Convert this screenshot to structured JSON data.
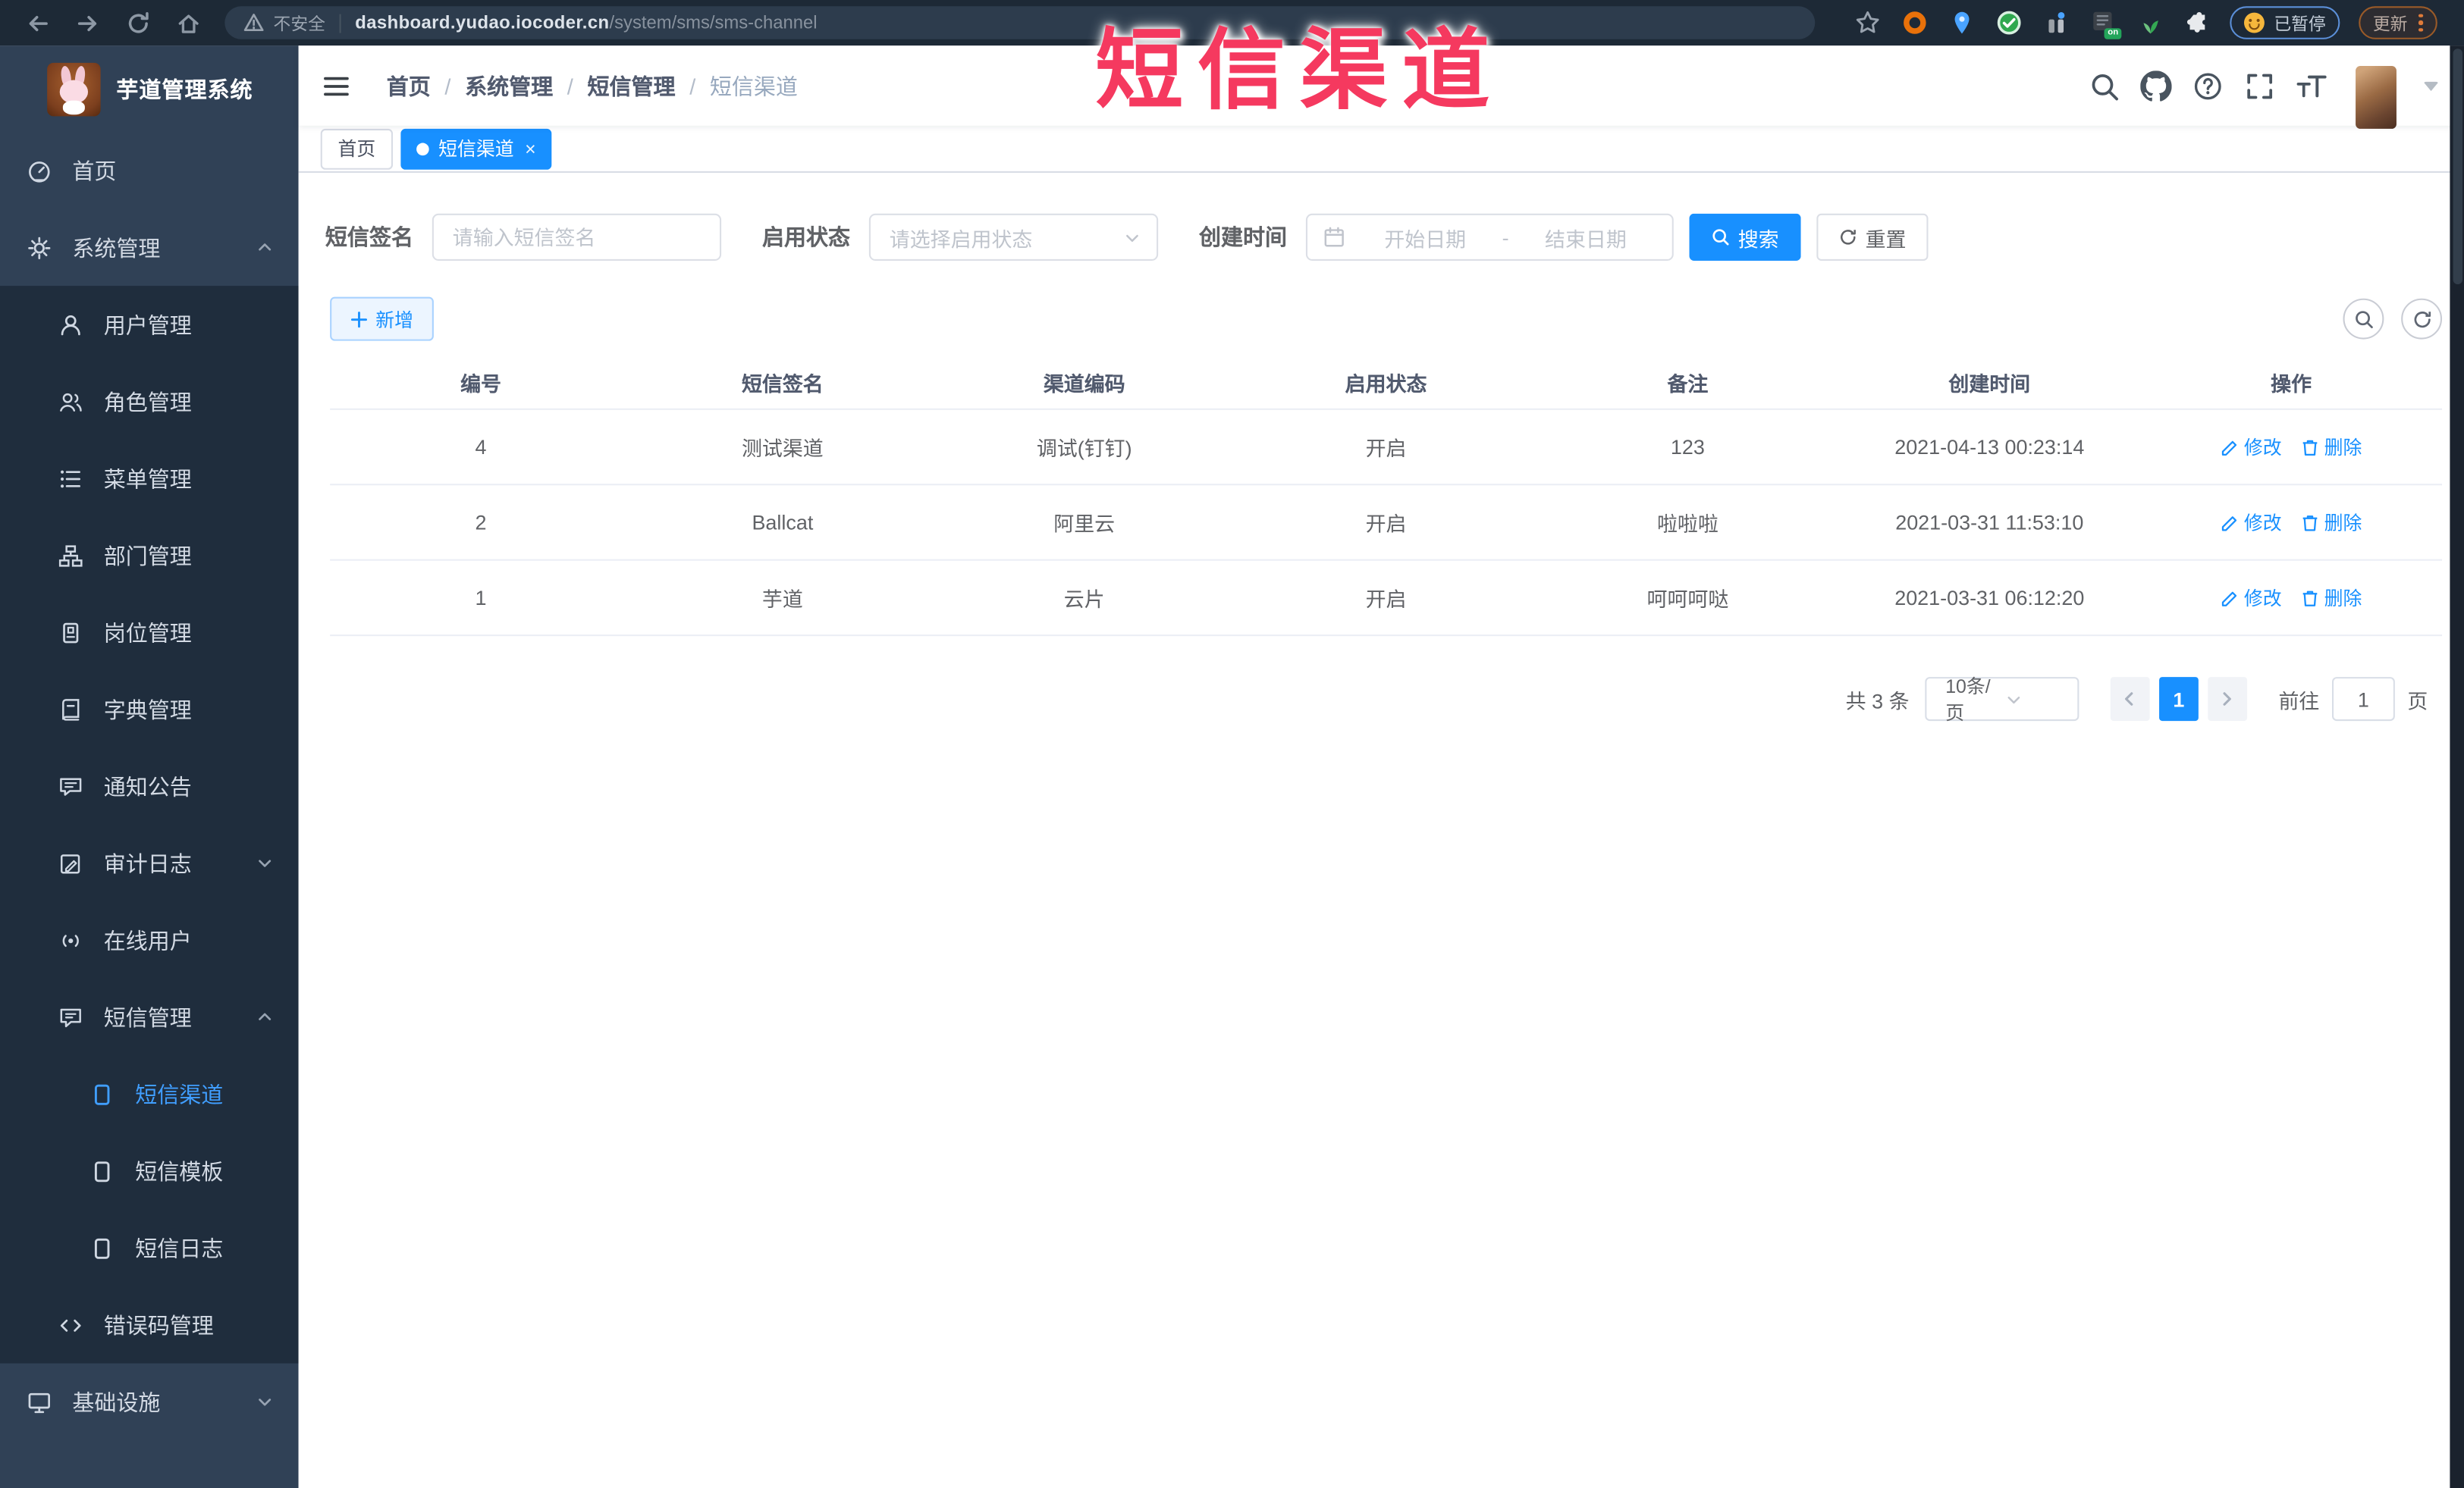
{
  "browser": {
    "security_label": "不安全",
    "url_host": "dashboard.yudao.iocoder.cn",
    "url_path": "/system/sms/sms-channel",
    "paused_badge": "已暂停",
    "update_label": "更新",
    "extension_on_badge": "on"
  },
  "overlay": {
    "title": "短信渠道",
    "color": "#f5395f"
  },
  "sidebar": {
    "logo_title": "芋道管理系统",
    "items": [
      {
        "label": "首页"
      },
      {
        "label": "系统管理"
      },
      {
        "label": "用户管理"
      },
      {
        "label": "角色管理"
      },
      {
        "label": "菜单管理"
      },
      {
        "label": "部门管理"
      },
      {
        "label": "岗位管理"
      },
      {
        "label": "字典管理"
      },
      {
        "label": "通知公告"
      },
      {
        "label": "审计日志"
      },
      {
        "label": "在线用户"
      },
      {
        "label": "短信管理"
      },
      {
        "label": "短信渠道"
      },
      {
        "label": "短信模板"
      },
      {
        "label": "短信日志"
      },
      {
        "label": "错误码管理"
      },
      {
        "label": "基础设施"
      }
    ]
  },
  "breadcrumb": {
    "items": [
      "首页",
      "系统管理",
      "短信管理",
      "短信渠道"
    ],
    "separator": "/"
  },
  "tags": {
    "home": "首页",
    "active": "短信渠道",
    "close": "×"
  },
  "filters": {
    "sign_label": "短信签名",
    "sign_placeholder": "请输入短信签名",
    "status_label": "启用状态",
    "status_placeholder": "请选择启用状态",
    "date_label": "创建时间",
    "date_start": "开始日期",
    "date_separator": "-",
    "date_end": "结束日期",
    "search_label": "搜索",
    "reset_label": "重置"
  },
  "toolbar": {
    "add_label": "新增"
  },
  "table": {
    "columns": [
      "编号",
      "短信签名",
      "渠道编码",
      "启用状态",
      "备注",
      "创建时间",
      "操作"
    ],
    "rows": [
      {
        "id": "4",
        "sign": "测试渠道",
        "code": "调试(钉钉)",
        "status": "开启",
        "remark": "123",
        "created": "2021-04-13 00:23:14"
      },
      {
        "id": "2",
        "sign": "Ballcat",
        "code": "阿里云",
        "status": "开启",
        "remark": "啦啦啦",
        "created": "2021-03-31 11:53:10"
      },
      {
        "id": "1",
        "sign": "芋道",
        "code": "云片",
        "status": "开启",
        "remark": "呵呵呵哒",
        "created": "2021-03-31 06:12:20"
      }
    ],
    "edit_label": "修改",
    "delete_label": "删除"
  },
  "pagination": {
    "total": "共 3 条",
    "per_page": "10条/页",
    "current_page": "1",
    "goto_label": "前往",
    "goto_value": "1",
    "page_suffix": "页"
  },
  "colors": {
    "accent": "#1890ff",
    "sidebar_bg": "#304156",
    "submenu_bg": "#1f2d3d",
    "active_menu": "#409eff",
    "overlay_red": "#f5395f"
  }
}
